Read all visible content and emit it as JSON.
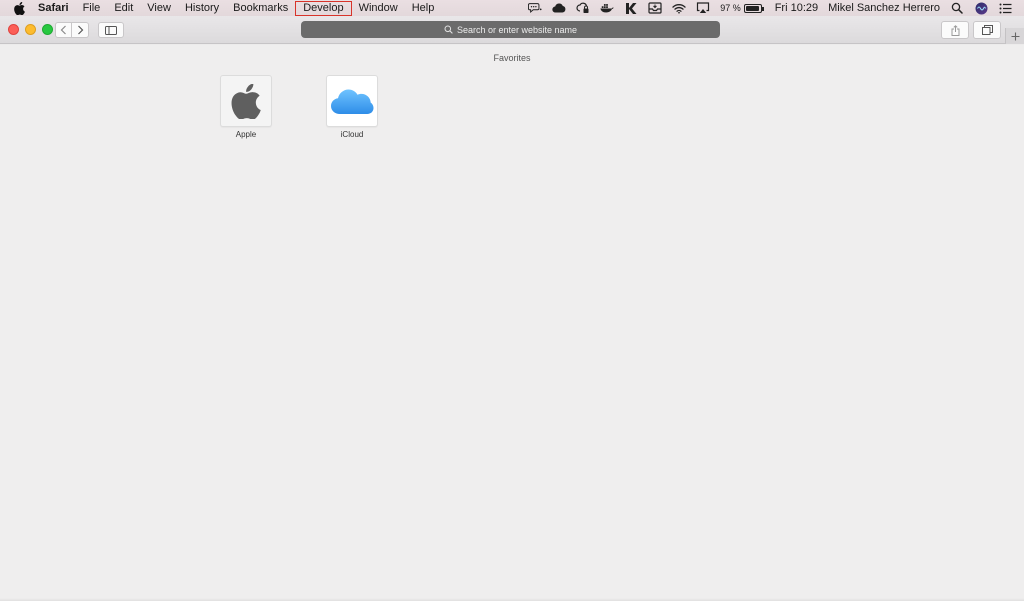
{
  "menubar": {
    "app_name": "Safari",
    "items": [
      "File",
      "Edit",
      "View",
      "History",
      "Bookmarks",
      "Develop",
      "Window",
      "Help"
    ],
    "highlighted_item": "Develop",
    "highlight_color": "#d8332a",
    "status": {
      "battery_percent": "97 %",
      "battery_level": 0.97,
      "clock": "Fri 10:29",
      "user_name": "Mikel Sanchez Herrero",
      "icons": [
        "chat-bubble-icon",
        "creative-cloud-icon",
        "cloud-lock-icon",
        "docker-icon",
        "k-app-icon",
        "inbox-icon",
        "wifi-icon",
        "airplay-icon",
        "battery-icon",
        "spotlight-search-icon",
        "siri-icon",
        "notification-center-icon"
      ]
    }
  },
  "toolbar": {
    "address_placeholder": "Search or enter website name",
    "buttons": [
      "back-icon",
      "forward-icon",
      "sidebar-icon",
      "share-icon",
      "tabs-overview-icon",
      "new-tab-icon"
    ]
  },
  "favorites": {
    "title": "Favorites",
    "items": [
      {
        "label": "Apple",
        "icon": "apple-logo-icon"
      },
      {
        "label": "iCloud",
        "icon": "icloud-icon"
      }
    ]
  },
  "colors": {
    "close": "#fc5f57",
    "minimize": "#fdbc2e",
    "maximize": "#27c840",
    "icloud_blue": "#3aa0f0"
  }
}
